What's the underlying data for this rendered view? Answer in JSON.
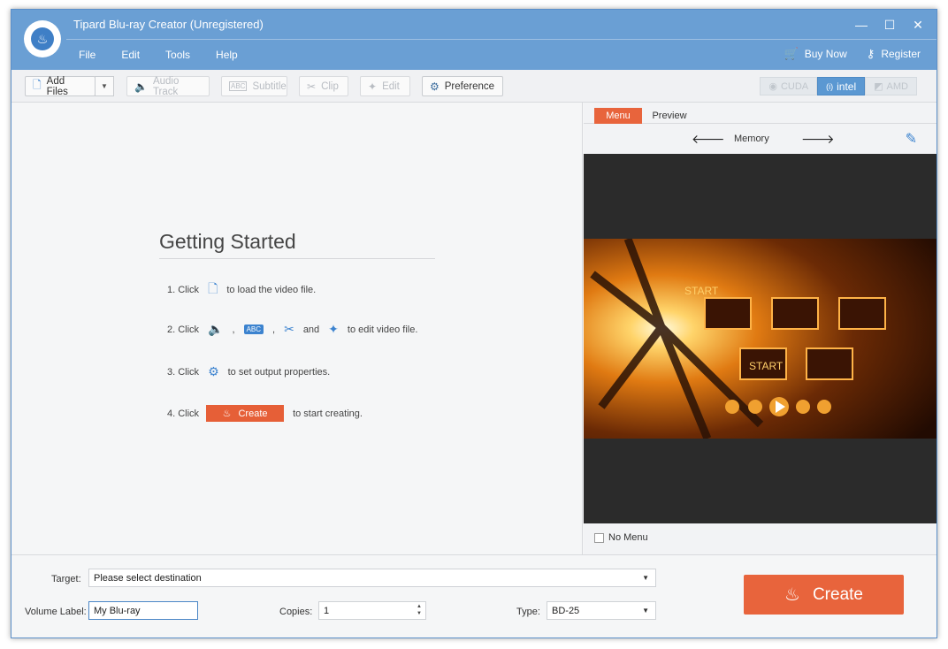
{
  "window": {
    "title": "Tipard Blu-ray Creator (Unregistered)",
    "controls": [
      "—",
      "☐",
      "✕"
    ]
  },
  "menu": [
    "File",
    "Edit",
    "Tools",
    "Help"
  ],
  "header_links": {
    "buy": "Buy Now",
    "register": "Register"
  },
  "toolbar": {
    "add_files": "Add Files",
    "audio_track": "Audio Track",
    "subtitle": "Subtitle",
    "clip": "Clip",
    "edit": "Edit",
    "preference": "Preference",
    "accel": [
      "CUDA",
      "intel",
      "AMD"
    ],
    "accel_active": "intel"
  },
  "getting_started": {
    "title": "Getting Started",
    "step1_prefix": "1. Click",
    "step1_suffix": "to load the video file.",
    "step2_prefix": "2. Click",
    "step2_abc": "ABC",
    "step2_and": "and",
    "step2_suffix": "to edit video file.",
    "step3_prefix": "3. Click",
    "step3_suffix": "to set output properties.",
    "step4_prefix": "4. Click",
    "step4_button": "Create",
    "step4_suffix": "to start creating."
  },
  "right_panel": {
    "tab_menu": "Menu",
    "tab_preview": "Preview",
    "template_name": "Memory",
    "preview_text_1": "START",
    "preview_text_2": "START",
    "no_menu_label": "No Menu",
    "no_menu_checked": false
  },
  "bottom": {
    "target_label": "Target:",
    "target_value": "Please select destination",
    "volume_label": "Volume Label:",
    "volume_value": "My Blu-ray",
    "copies_label": "Copies:",
    "copies_value": "1",
    "type_label": "Type:",
    "type_value": "BD-25",
    "create_label": "Create"
  },
  "colors": {
    "titlebar": "#6a9fd4",
    "accent": "#e8643c",
    "icon_blue": "#3c83cf"
  }
}
